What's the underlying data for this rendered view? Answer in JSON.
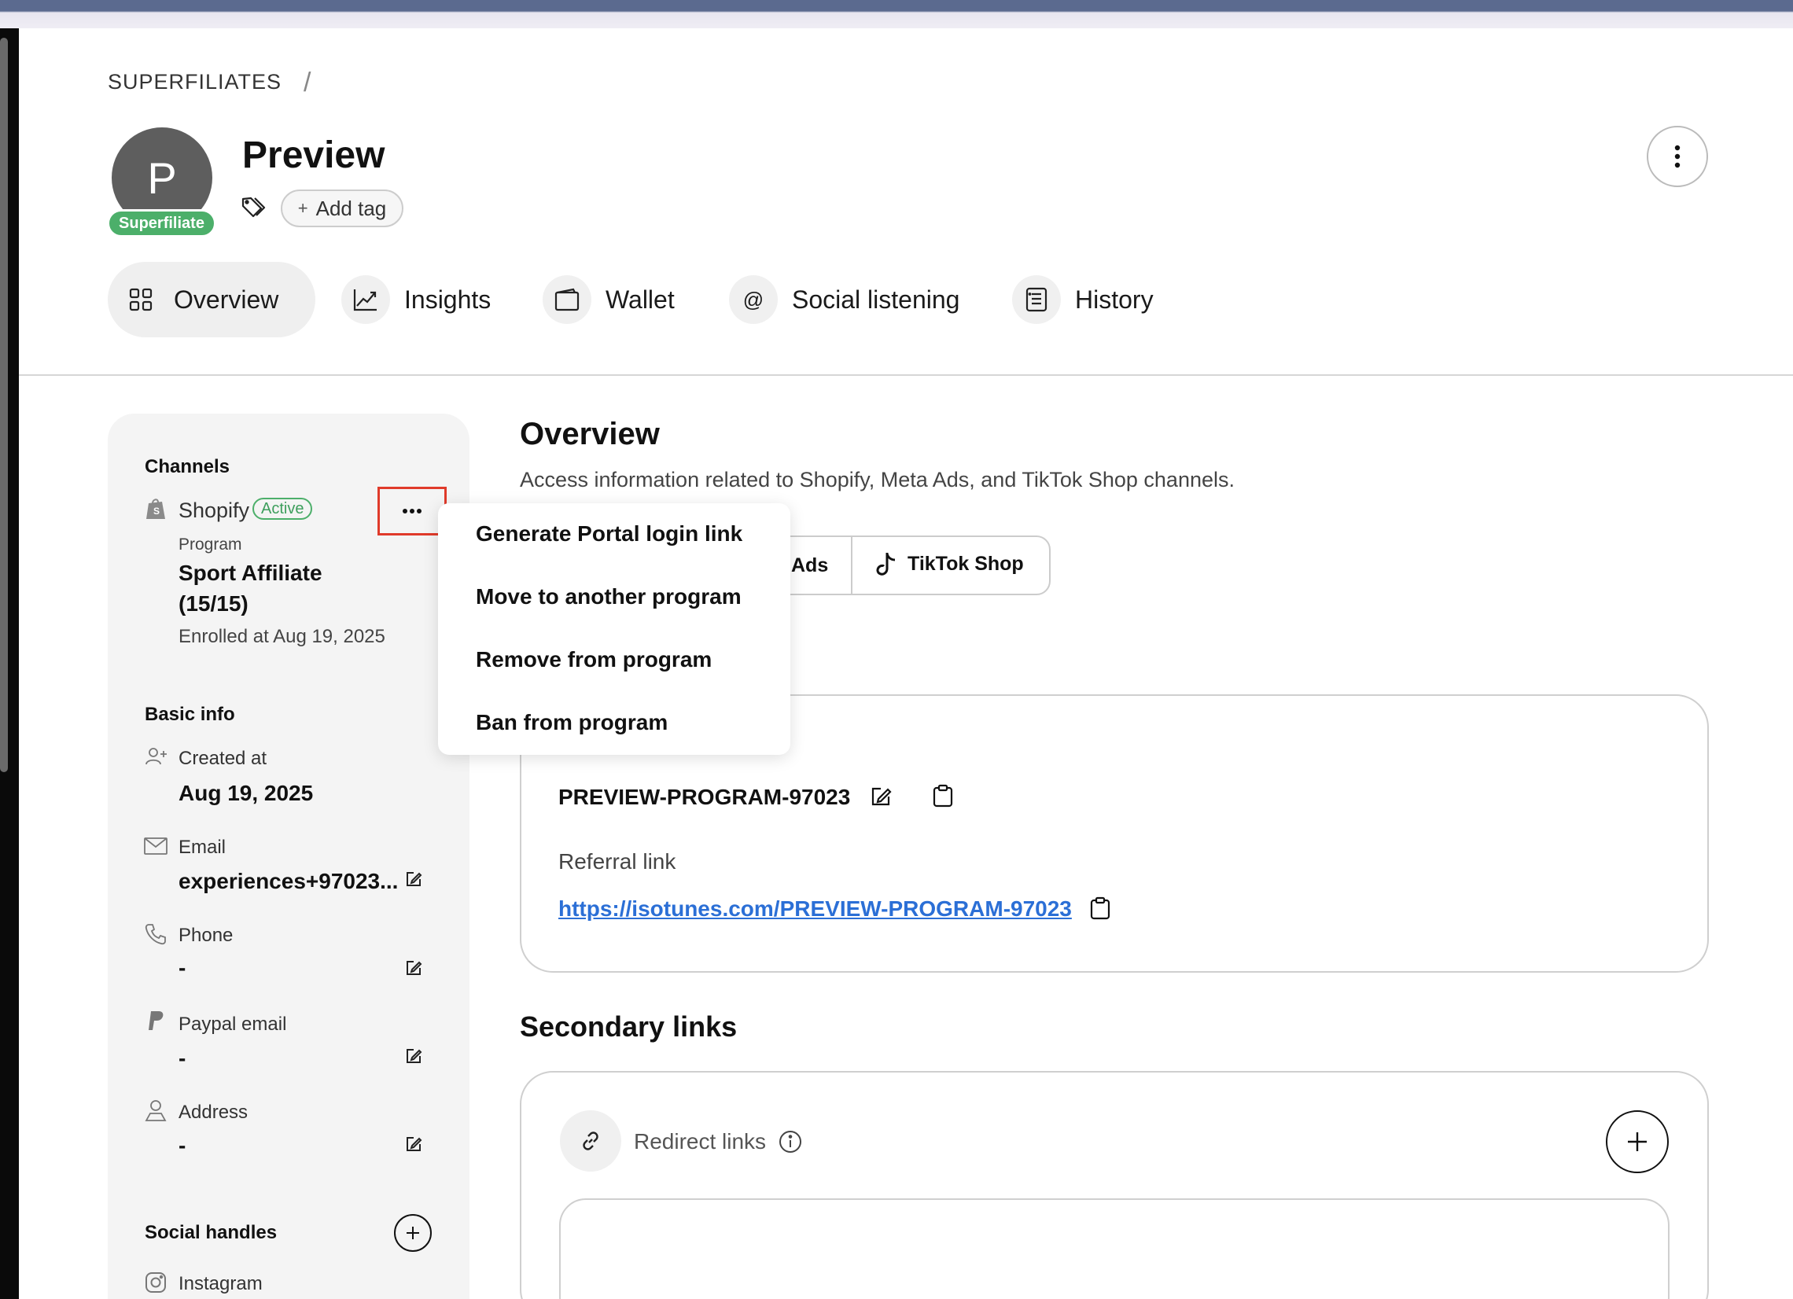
{
  "breadcrumb": {
    "root": "SUPERFILIATES",
    "separator": "/"
  },
  "profile": {
    "avatar_letter": "P",
    "badge": "Superfiliate",
    "name": "Preview",
    "add_tag_label": "Add tag"
  },
  "tabs": [
    {
      "label": "Overview",
      "icon": "grid-icon",
      "selected": true
    },
    {
      "label": "Insights",
      "icon": "chart-line-icon"
    },
    {
      "label": "Wallet",
      "icon": "wallet-icon"
    },
    {
      "label": "Social listening",
      "icon": "at-icon"
    },
    {
      "label": "History",
      "icon": "history-list-icon"
    }
  ],
  "sidebar": {
    "channels_title": "Channels",
    "shopify": {
      "name": "Shopify",
      "status": "Active",
      "program_label": "Program",
      "program_name_line1": "Sport Affiliate",
      "program_name_line2": "(15/15)",
      "enrolled": "Enrolled at Aug 19, 2025"
    },
    "basic_info_title": "Basic info",
    "fields": [
      {
        "label": "Created at",
        "value": "Aug 19, 2025",
        "icon": "user-plus-icon"
      },
      {
        "label": "Email",
        "value": "experiences+97023...",
        "icon": "mail-icon"
      },
      {
        "label": "Phone",
        "value": "-",
        "icon": "phone-icon"
      },
      {
        "label": "Paypal email",
        "value": "-",
        "icon": "paypal-icon"
      },
      {
        "label": "Address",
        "value": "-",
        "icon": "user-location-icon"
      }
    ],
    "social_title": "Social handles",
    "social_items": [
      {
        "label": "Instagram",
        "icon": "instagram-icon"
      }
    ]
  },
  "dropdown": {
    "items": [
      "Generate Portal login link",
      "Move to another program",
      "Remove from program",
      "Ban from program"
    ]
  },
  "main": {
    "title": "Overview",
    "description": "Access information related to Shopify, Meta Ads, and TikTok Shop channels.",
    "channel_tabs": {
      "ads_partial": "Ads",
      "tiktok": "TikTok Shop"
    },
    "code": "PREVIEW-PROGRAM-97023",
    "referral_label": "Referral link",
    "referral_link": "https://isotunes.com/PREVIEW-PROGRAM-97023",
    "secondary_title": "Secondary links",
    "redirect_label": "Redirect links"
  },
  "colors": {
    "accent_green": "#4caf6a",
    "highlight_red": "#e03a2a",
    "link_blue": "#2b6fd6"
  }
}
